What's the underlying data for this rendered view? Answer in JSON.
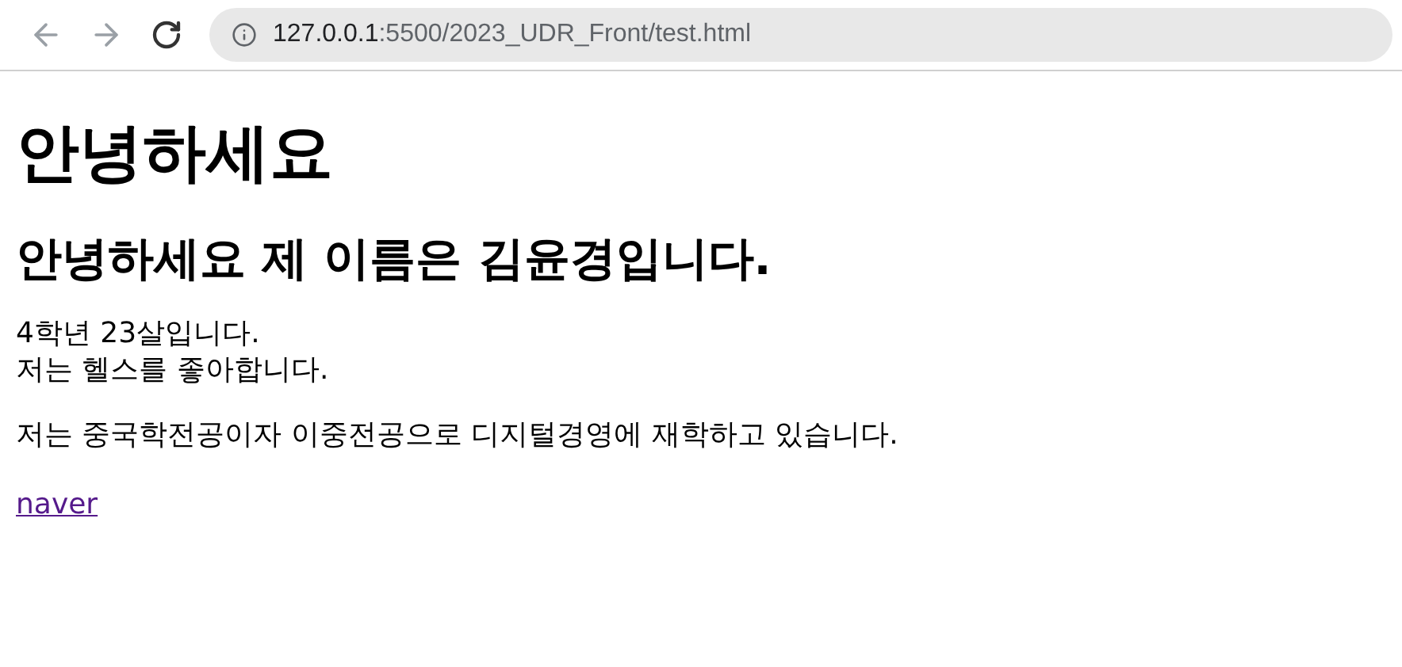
{
  "browser": {
    "url_host": "127.0.0.1",
    "url_path": ":5500/2023_UDR_Front/test.html"
  },
  "heading_1": "안녕하세요",
  "heading_2": "안녕하세요 제 이름은 김윤경입니다.",
  "paragraphs": [
    {
      "lines": [
        "4학년 23살입니다.",
        "저는 헬스를 좋아합니다."
      ]
    },
    {
      "lines": [
        "저는 중국학전공이자 이중전공으로 디지털경영에 재학하고 있습니다."
      ]
    }
  ],
  "link": "naver"
}
